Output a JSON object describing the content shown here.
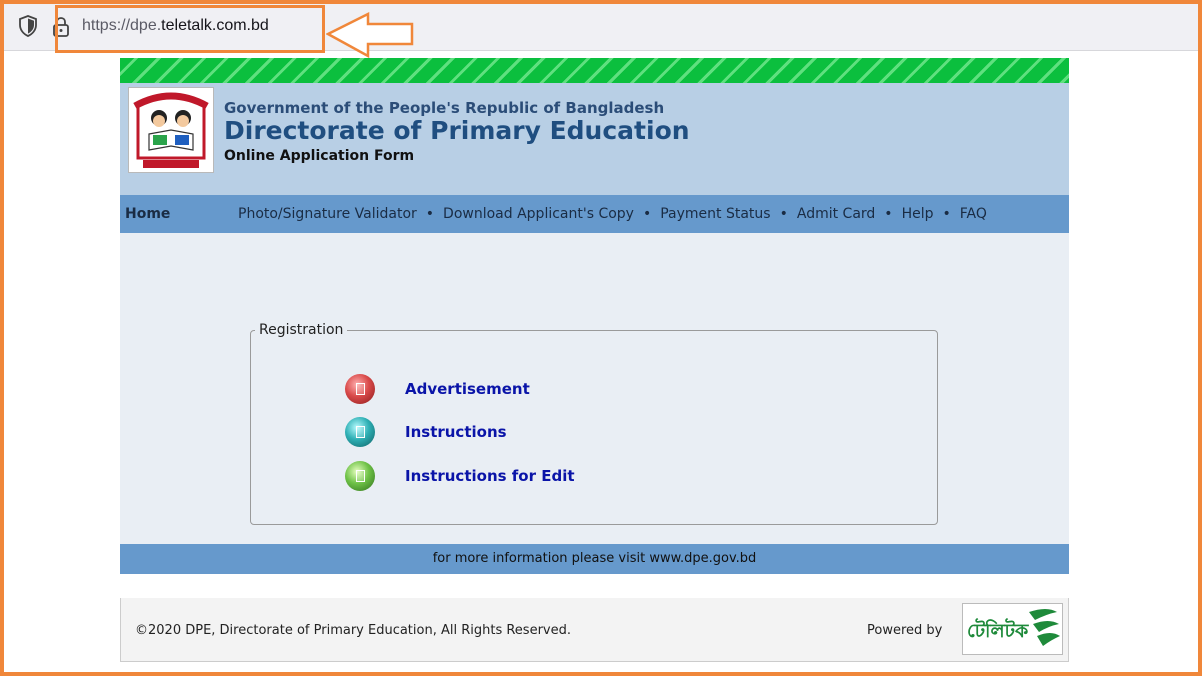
{
  "browser": {
    "url_scheme": "https://dpe.",
    "url_host": "teletalk.com.bd",
    "icons": [
      "shield-icon",
      "lock-icon"
    ]
  },
  "annotation": {
    "highlight_color": "#f0873a",
    "icon": "arrow-left-icon"
  },
  "header": {
    "gov_title": "Government of the People's Republic of Bangladesh",
    "dept_title": "Directorate of Primary Education",
    "form_title": "Online Application Form"
  },
  "nav": {
    "home": "Home",
    "links": [
      "Photo/Signature Validator",
      "Download Applicant's Copy",
      "Payment Status",
      "Admit Card",
      "Help",
      "FAQ"
    ],
    "separator": "•"
  },
  "registration": {
    "legend": "Registration",
    "items": [
      {
        "label": "Advertisement",
        "icon": "document-icon-red"
      },
      {
        "label": "Instructions",
        "icon": "document-icon-cyan"
      },
      {
        "label": "Instructions for Edit",
        "icon": "document-icon-green"
      }
    ]
  },
  "info_bar": {
    "text": "for more information please visit www.dpe.gov.bd"
  },
  "footer": {
    "copyright": "©2020 DPE, Directorate of Primary Education, All Rights Reserved.",
    "powered_by": "Powered by",
    "logo_text": "টেলিটক"
  },
  "colors": {
    "stripe_green": "#0bbf3e",
    "header_bg": "#b8cfe5",
    "nav_bg": "#6699cc",
    "content_bg": "#e9eef4",
    "link_color": "#0a14a8",
    "title_color": "#1f4e80"
  }
}
